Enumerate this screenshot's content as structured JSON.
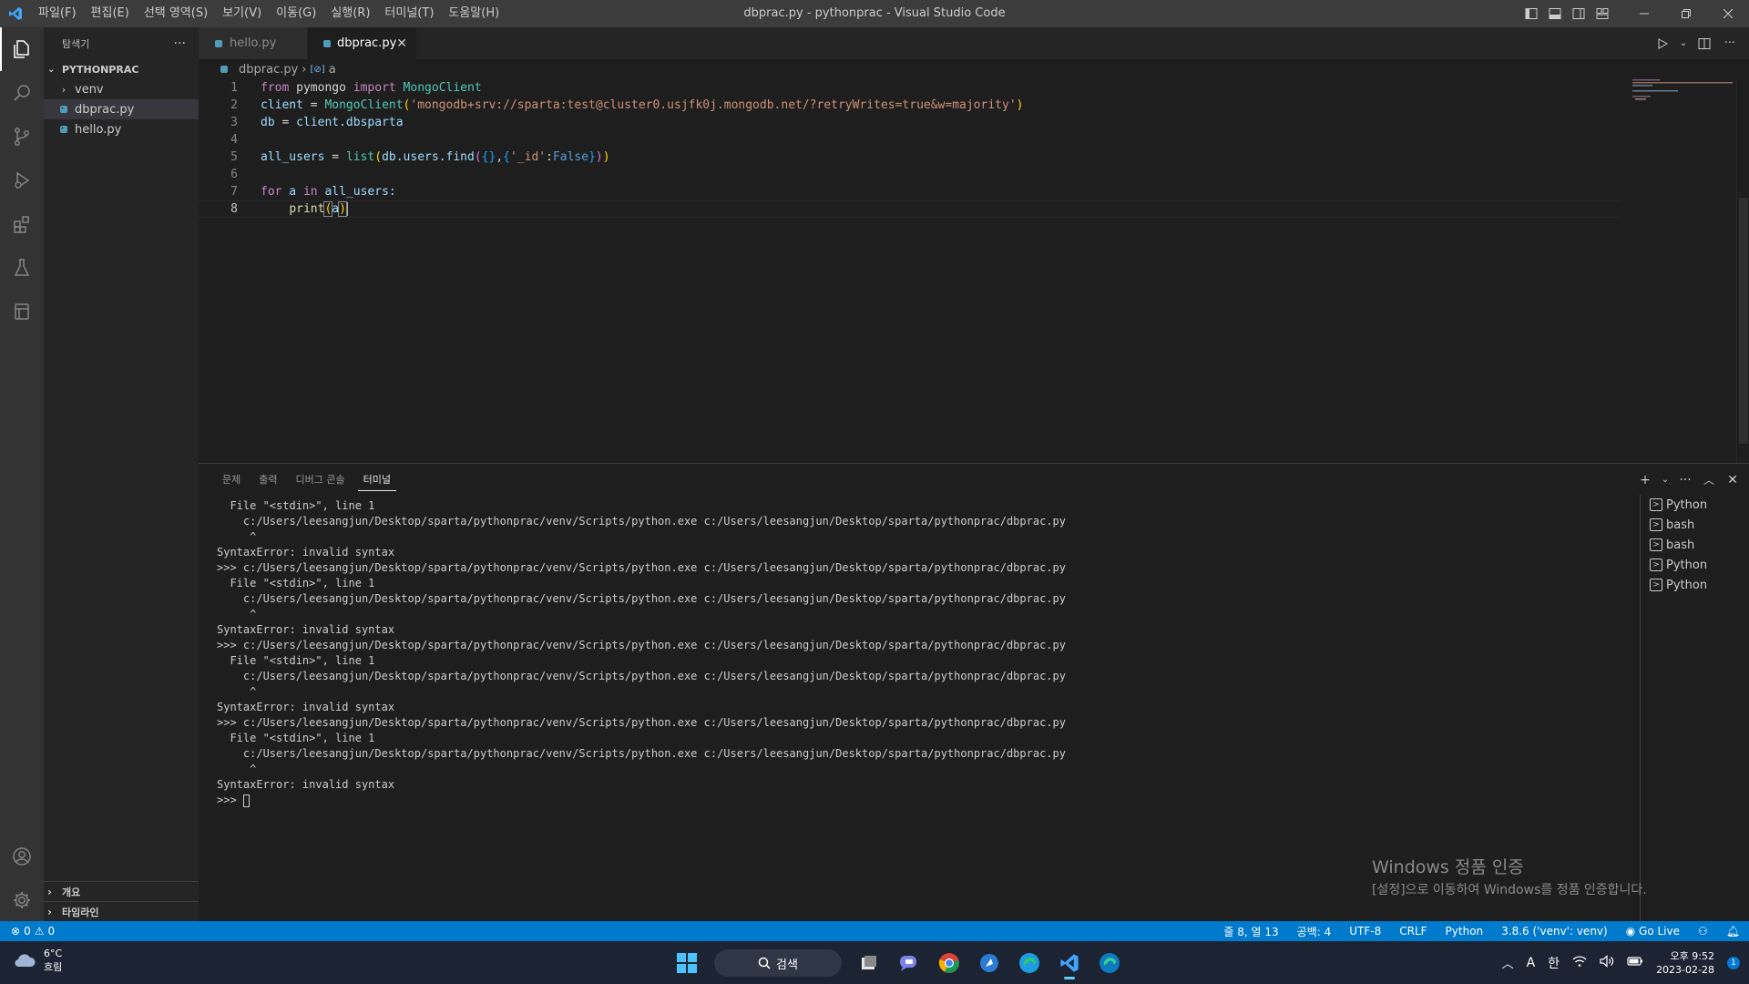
{
  "titlebar": {
    "menu": [
      "파일(F)",
      "편집(E)",
      "선택 영역(S)",
      "보기(V)",
      "이동(G)",
      "실행(R)",
      "터미널(T)",
      "도움말(H)"
    ],
    "window_title": "dbprac.py - pythonprac - Visual Studio Code"
  },
  "sidebar": {
    "header": "탐색기",
    "project": "PYTHONPRAC",
    "items": [
      {
        "label": "venv",
        "type": "folder"
      },
      {
        "label": "dbprac.py",
        "type": "file"
      },
      {
        "label": "hello.py",
        "type": "file"
      }
    ],
    "outline": "개요",
    "timeline": "타임라인"
  },
  "tabs": [
    {
      "label": "hello.py"
    },
    {
      "label": "dbprac.py"
    }
  ],
  "breadcrumb": {
    "file": "dbprac.py",
    "symbol": "a"
  },
  "code": {
    "line_numbers": [
      "1",
      "2",
      "3",
      "4",
      "5",
      "6",
      "7",
      "8"
    ],
    "l1": {
      "kw1": "from",
      "mod": " pymongo ",
      "kw2": "import",
      "name": " MongoClient"
    },
    "l2": {
      "var": "client",
      "eq": " = ",
      "cls": "MongoClient",
      "open": "(",
      "str": "'mongodb+srv://sparta:test@cluster0.usjfk0j.mongodb.net/?retryWrites=true&w=majority'",
      "close": ")"
    },
    "l3": {
      "var": "db",
      "eq": " = ",
      "rest": "client.dbsparta"
    },
    "l5": {
      "var": "all_users",
      "eq": " = ",
      "fn": "list",
      "open": "(",
      "mid": "db.users.find",
      "open2": "(",
      "args1": "{}",
      "comma": ",",
      "dict_open": "{",
      "key": "'_id'",
      "colon": ":",
      "val": "False",
      "dict_close": "}",
      "close2": ")",
      "close": ")"
    },
    "l7": {
      "kw1": "for",
      "a": " a ",
      "kw2": "in",
      "rest": " all_users:"
    },
    "l8": {
      "indent": "    ",
      "fn": "print",
      "open": "(",
      "arg": "a",
      "close": ")"
    }
  },
  "panel": {
    "tabs": [
      "문제",
      "출력",
      "디버그 콘솔",
      "터미널"
    ],
    "terminal_lines": [
      "  File \"<stdin>\", line 1",
      "    c:/Users/leesangjun/Desktop/sparta/pythonprac/venv/Scripts/python.exe c:/Users/leesangjun/Desktop/sparta/pythonprac/dbprac.py",
      "     ^",
      "SyntaxError: invalid syntax",
      ">>> c:/Users/leesangjun/Desktop/sparta/pythonprac/venv/Scripts/python.exe c:/Users/leesangjun/Desktop/sparta/pythonprac/dbprac.py",
      "  File \"<stdin>\", line 1",
      "    c:/Users/leesangjun/Desktop/sparta/pythonprac/venv/Scripts/python.exe c:/Users/leesangjun/Desktop/sparta/pythonprac/dbprac.py",
      "     ^",
      "SyntaxError: invalid syntax",
      ">>> c:/Users/leesangjun/Desktop/sparta/pythonprac/venv/Scripts/python.exe c:/Users/leesangjun/Desktop/sparta/pythonprac/dbprac.py",
      "  File \"<stdin>\", line 1",
      "    c:/Users/leesangjun/Desktop/sparta/pythonprac/venv/Scripts/python.exe c:/Users/leesangjun/Desktop/sparta/pythonprac/dbprac.py",
      "     ^",
      "SyntaxError: invalid syntax",
      ">>> c:/Users/leesangjun/Desktop/sparta/pythonprac/venv/Scripts/python.exe c:/Users/leesangjun/Desktop/sparta/pythonprac/dbprac.py",
      "  File \"<stdin>\", line 1",
      "    c:/Users/leesangjun/Desktop/sparta/pythonprac/venv/Scripts/python.exe c:/Users/leesangjun/Desktop/sparta/pythonprac/dbprac.py",
      "     ^",
      "SyntaxError: invalid syntax"
    ],
    "prompt": ">>> ",
    "terminals": [
      "Python",
      "bash",
      "bash",
      "Python",
      "Python"
    ]
  },
  "watermark": {
    "title": "Windows 정품 인증",
    "subtitle": "[설정]으로 이동하여 Windows를 정품 인증합니다."
  },
  "statusbar": {
    "errors": "0",
    "warnings": "0",
    "position": "줄 8, 열 13",
    "spaces": "공백: 4",
    "encoding": "UTF-8",
    "eol": "CRLF",
    "language": "Python",
    "interpreter": "3.8.6 ('venv': venv)",
    "golive": "Go Live"
  },
  "taskbar": {
    "temp": "6°C",
    "weather": "흐림",
    "search": "검색",
    "ime": "A",
    "lang": "한",
    "time": "오후 9:52",
    "date": "2023-02-28",
    "notifications": "1"
  },
  "colors": {
    "accent": "#007acc",
    "python_icon": "#519aba"
  }
}
